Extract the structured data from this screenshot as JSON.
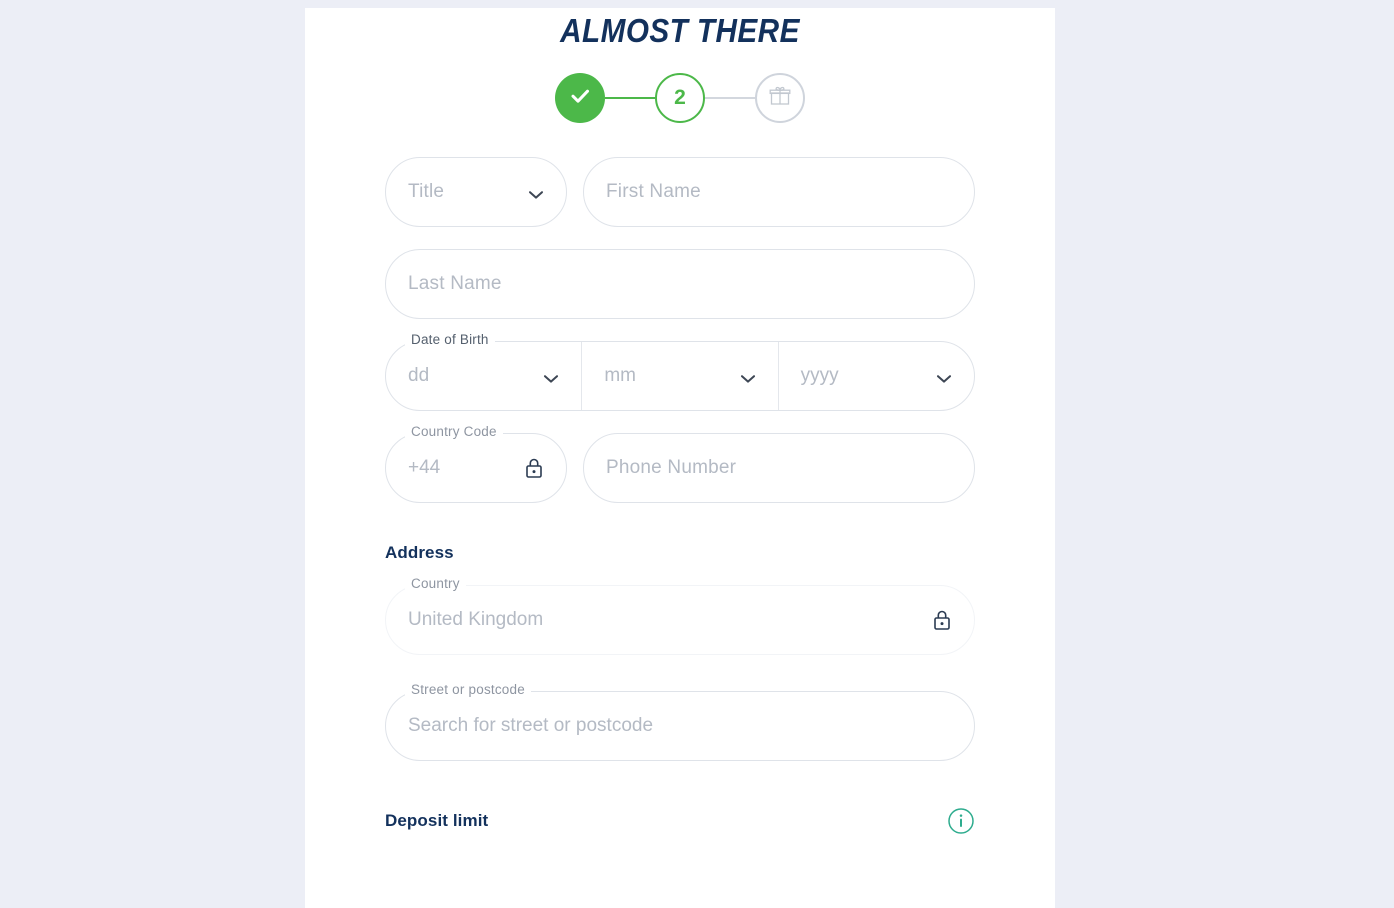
{
  "page": {
    "background_color": "#eceef6",
    "card_background": "#ffffff"
  },
  "colors": {
    "navy": "#13315c",
    "green": "#4cb849",
    "teal": "#2eac8e",
    "placeholder": "#b4bac4",
    "border": "#dfe3e9"
  },
  "header": {
    "title": "ALMOST THERE"
  },
  "stepper": {
    "steps": [
      {
        "id": "step-1",
        "label": "",
        "state": "done",
        "icon": "check-icon"
      },
      {
        "id": "step-2",
        "label": "2",
        "state": "current",
        "icon": ""
      },
      {
        "id": "step-3",
        "label": "",
        "state": "future",
        "icon": "gift-icon"
      }
    ]
  },
  "form": {
    "title_select": {
      "placeholder": "Title",
      "value": "",
      "icon": "chevron-down-icon"
    },
    "first_name": {
      "placeholder": "First Name",
      "value": ""
    },
    "last_name": {
      "placeholder": "Last Name",
      "value": ""
    },
    "date_of_birth": {
      "legend": "Date of Birth",
      "day": {
        "placeholder": "dd",
        "value": "",
        "icon": "chevron-down-icon"
      },
      "month": {
        "placeholder": "mm",
        "value": "",
        "icon": "chevron-down-icon"
      },
      "year": {
        "placeholder": "yyyy",
        "value": "",
        "icon": "chevron-down-icon"
      }
    },
    "country_code": {
      "legend": "Country Code",
      "value": "+44",
      "icon": "lock-icon",
      "locked": true
    },
    "phone_number": {
      "placeholder": "Phone Number",
      "value": ""
    }
  },
  "address": {
    "heading": "Address",
    "country": {
      "legend": "Country",
      "value": "United Kingdom",
      "icon": "lock-icon",
      "locked": true
    },
    "street": {
      "legend": "Street or postcode",
      "placeholder": "Search for street or postcode",
      "value": ""
    }
  },
  "deposit": {
    "heading": "Deposit limit",
    "info_icon": "info-circle-icon"
  }
}
